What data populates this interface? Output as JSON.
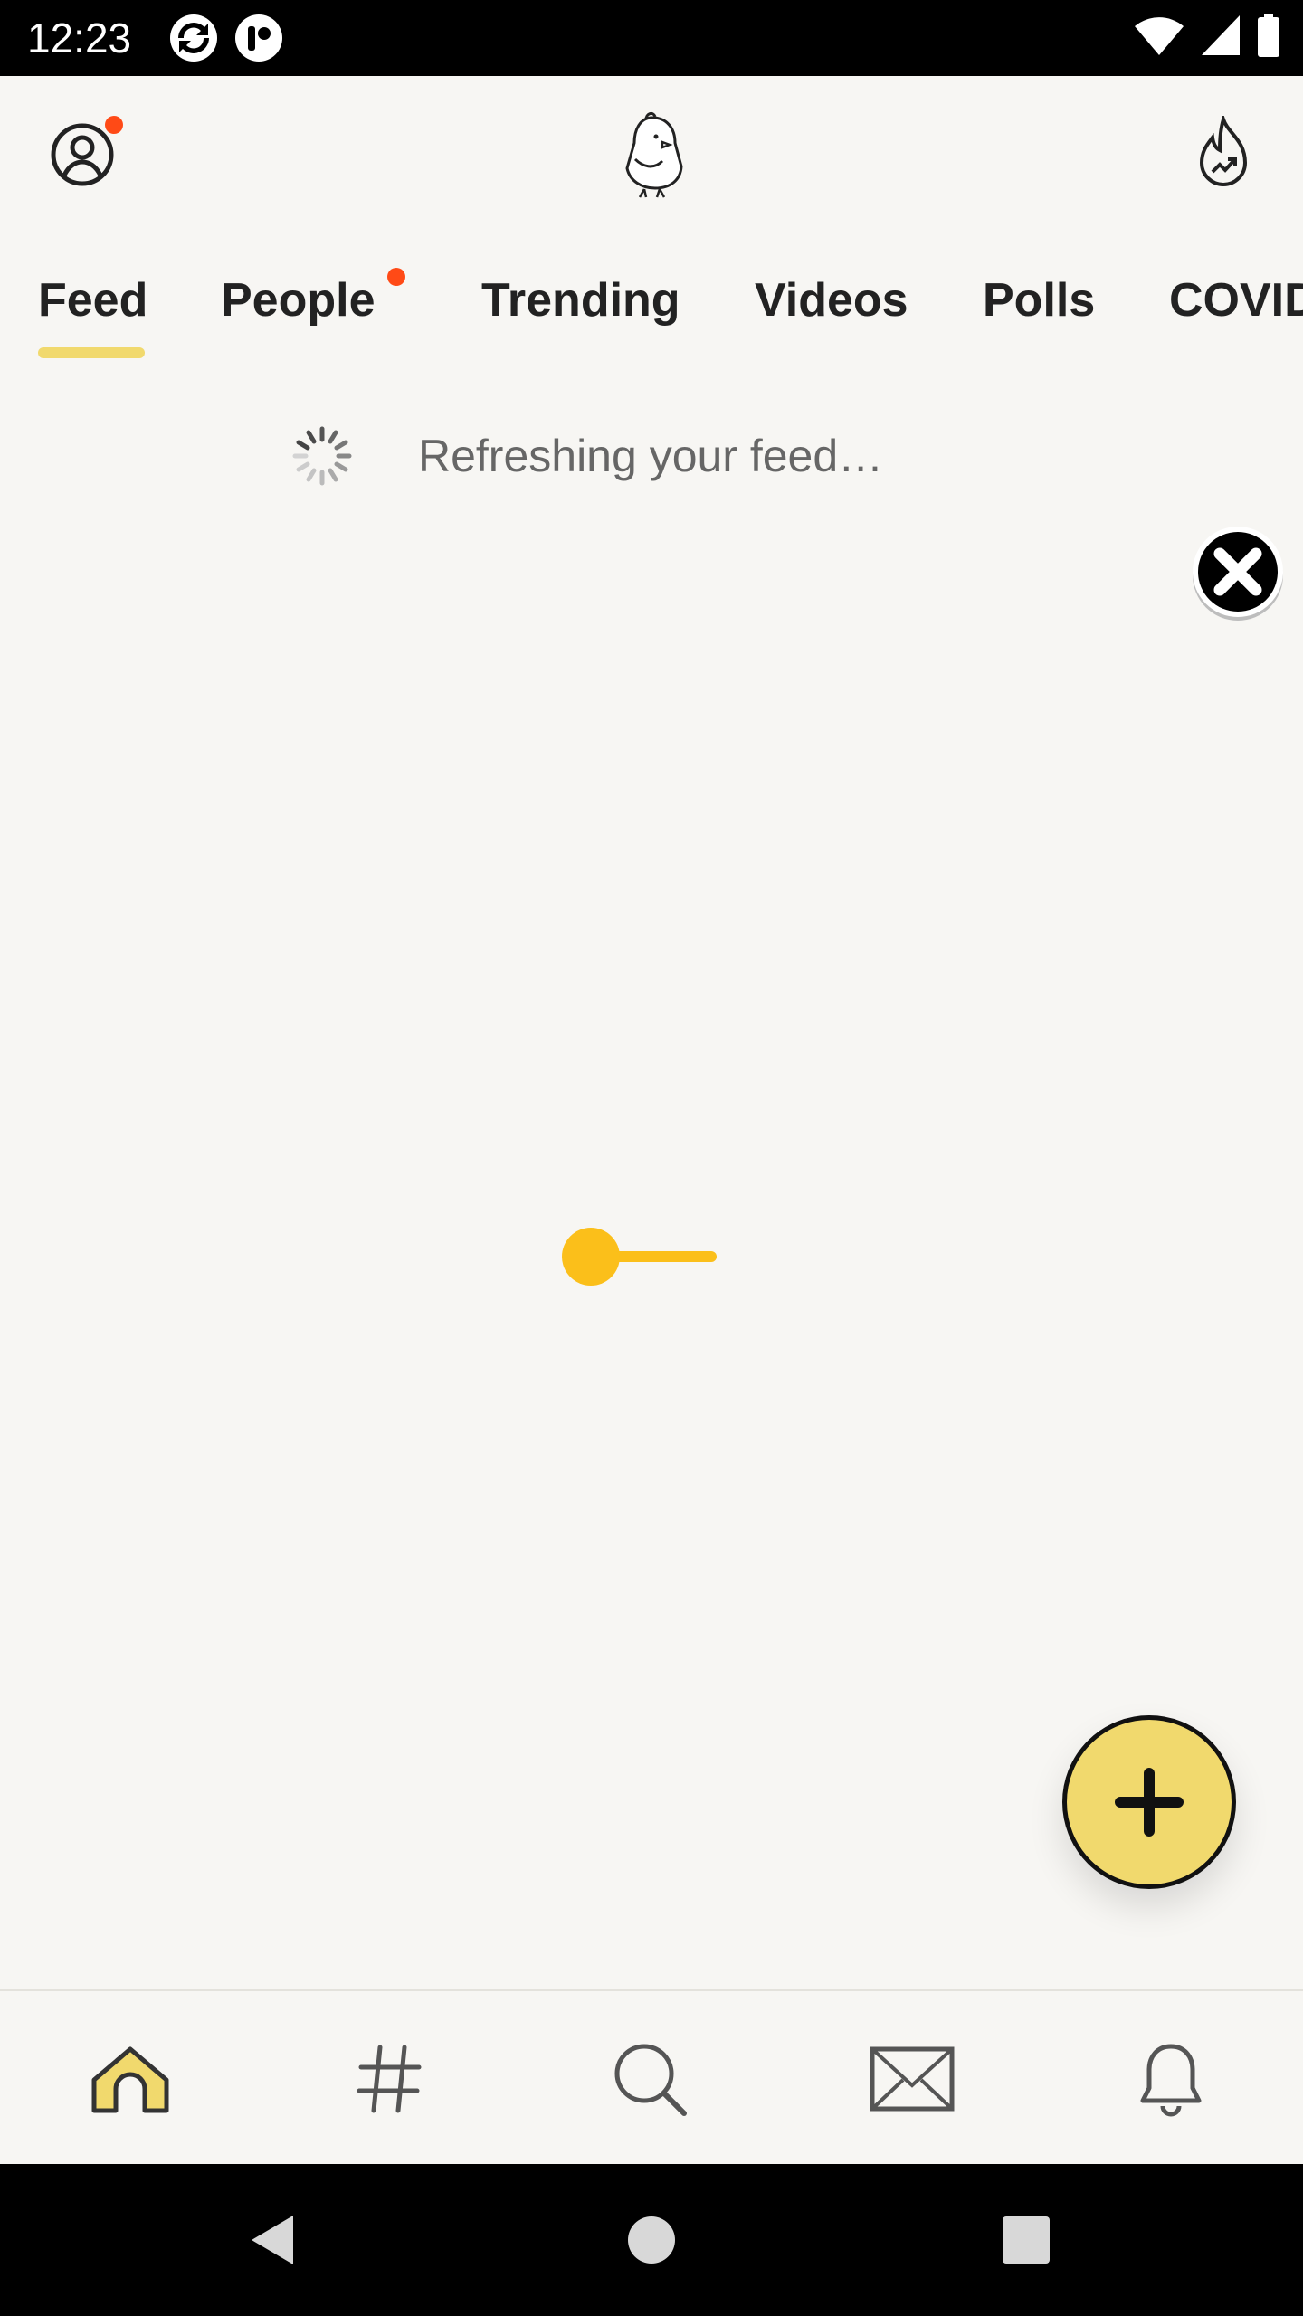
{
  "status_bar": {
    "time": "12:23",
    "icons": [
      "app-notification-icon",
      "tumblr-like-icon",
      "wifi-icon",
      "cellular-signal-icon",
      "battery-icon"
    ]
  },
  "header": {
    "profile_icon": "user-profile-icon",
    "logo_icon": "koo-bird-logo-icon",
    "trending_icon": "trending-flame-icon",
    "notification_dot_color": "#ff4a16"
  },
  "tabs": {
    "items": [
      {
        "label": "Feed",
        "active": true
      },
      {
        "label": "People",
        "has_dot": true
      },
      {
        "label": "Trending"
      },
      {
        "label": "Videos"
      },
      {
        "label": "Polls"
      },
      {
        "label": "COVID"
      }
    ],
    "active_color": "#f1d96d"
  },
  "feed": {
    "refresh_text": "Refreshing your feed…"
  },
  "close_overlay_icon": "close-x-icon",
  "loader_icon": "loading-indicator-icon",
  "fab": {
    "icon": "plus-icon",
    "color": "#f1d96d"
  },
  "bottom_nav": {
    "items": [
      {
        "icon": "home-icon",
        "active": true
      },
      {
        "icon": "hashtag-icon"
      },
      {
        "icon": "search-icon"
      },
      {
        "icon": "mail-icon"
      },
      {
        "icon": "bell-icon"
      }
    ]
  },
  "system_nav": {
    "items": [
      "back-icon",
      "home-circle-icon",
      "recents-icon"
    ]
  },
  "colors": {
    "background": "#f7f6f3",
    "accent_yellow": "#f1d96d",
    "loader_yellow": "#fbbf1a",
    "alert_red": "#ff4a16"
  }
}
